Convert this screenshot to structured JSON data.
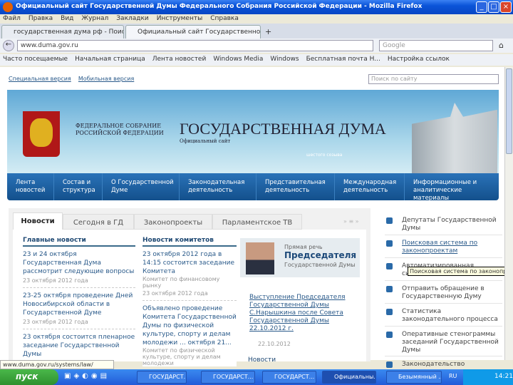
{
  "window": {
    "title": "Официальный сайт Государственной Думы Федерального Собрания Российской Федерации - Mozilla Firefox"
  },
  "menu": [
    "Файл",
    "Правка",
    "Вид",
    "Журнал",
    "Закладки",
    "Инструменты",
    "Справка"
  ],
  "tabs": [
    "государственная дума рф - Поиск в Go...",
    "Официальный сайт Государственной ..."
  ],
  "url": "www.duma.gov.ru",
  "search_placeholder": "Google",
  "bookmarks": [
    "Часто посещаемые",
    "Начальная страница",
    "Лента новостей",
    "Windows Media",
    "Windows",
    "Бесплатная почта H...",
    "Настройка ссылок"
  ],
  "page": {
    "top_links": [
      "Специальная версия",
      "Мобильная версия"
    ],
    "site_search_placeholder": "Поиск по сайту",
    "banner": {
      "org": "ФЕДЕРАЛЬНОЕ СОБРАНИЕ РОССИЙСКОЙ ФЕДЕРАЦИИ",
      "title": "ГОСУДАРСТВЕННАЯ ДУМА",
      "subtitle": "Официальный сайт",
      "convocation": "шестого созыва"
    },
    "nav": [
      "Лента новостей",
      "Состав и структура",
      "О Государственной Думе",
      "Законодательная деятельность",
      "Представительная деятельность",
      "Международная деятельность",
      "Информационные и аналитические материалы"
    ],
    "content_tabs": [
      "Новости",
      "Сегодня в ГД",
      "Законопроекты",
      "Парламентское ТВ"
    ],
    "main_news": {
      "heading": "Главные новости",
      "items": [
        {
          "title": "23 и 24 октября Государственная Дума рассмотрит следующие вопросы",
          "date": "23 октября 2012 года"
        },
        {
          "title": "23-25 октября проведение Дней Новосибирской области в Государственной Думе",
          "date": "23 октября 2012 года"
        },
        {
          "title": "23 октября состоится пленарное заседание Государственной Думы",
          "date": ""
        }
      ]
    },
    "committee_news": {
      "heading": "Новости комитетов",
      "items": [
        {
          "title": "23 октября 2012 года в 14:15 состоится заседание Комитета",
          "source": "Комитет по финансовому рынку",
          "date": "23 октября 2012 года"
        },
        {
          "title": "Объявлено проведение Комитета Государственной Думы по физической культуре, спорту и делам молодежи ... октября 21...",
          "source": "Комитет по физической культуре, спорту и делам молодежи",
          "date": ""
        }
      ]
    },
    "speech": {
      "line1": "Прямая речь",
      "line2": "Председателя",
      "line3": "Государственной Думы",
      "link": "Выступление Председателя Государственной Думы С.Нарышкина после Совета Государственной Думы 22.10.2012 г.",
      "date": "22.10.2012",
      "next_heading": "Новости"
    },
    "sidebar": [
      "Депутаты Государственной Думы",
      "Поисковая система по законопроектам",
      "Автоматизированная система ...",
      "Отправить обращение в Государственную Думу",
      "Статистика законодательного процесса",
      "Оперативные стенограммы заседаний Государственной Думы",
      "Законодательство"
    ],
    "tooltip": "Поисковая система по законопроектам"
  },
  "status_url": "www.duma.gov.ru/systems/law/",
  "taskbar": {
    "start": "пуск",
    "tasks": [
      "ГОСУДАРСТ...",
      "ГОСУДАРСТ...",
      "ГОСУДАРСТ...",
      "Официальны...",
      "Безымянный ...",
      "RU"
    ],
    "clock": "14:21"
  }
}
